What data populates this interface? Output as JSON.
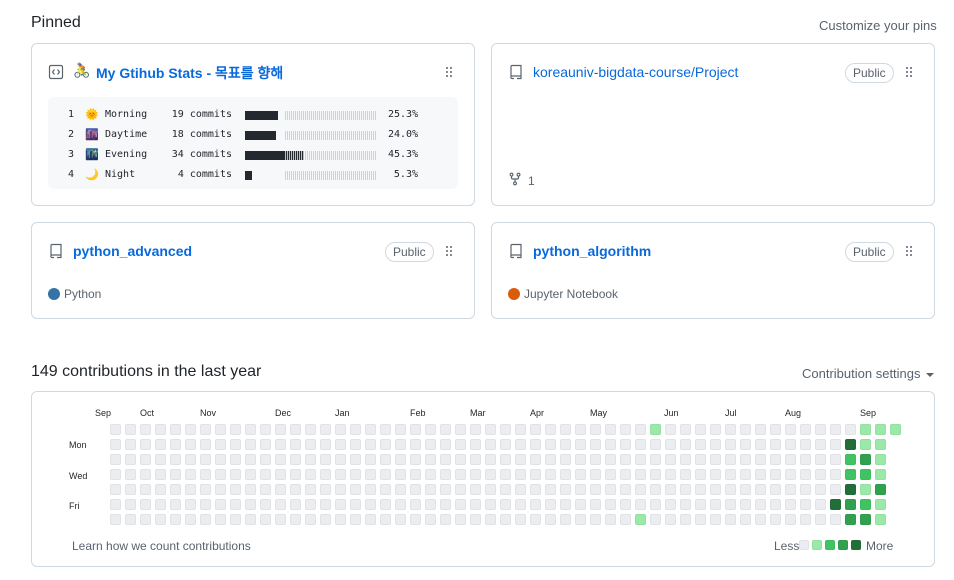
{
  "pinned": {
    "title": "Pinned",
    "customize_label": "Customize your pins",
    "cards": [
      {
        "name": "My Gtihub Stats - 목표를 향해",
        "emoji": "🚴",
        "type": "gist",
        "stats": [
          {
            "num": "1",
            "emoji": "🌞",
            "label": "Morning",
            "commits": "19 commits",
            "percent": "25.3%",
            "fraction": 0.253
          },
          {
            "num": "2",
            "emoji": "🌆",
            "label": "Daytime",
            "commits": "18 commits",
            "percent": "24.0%",
            "fraction": 0.24
          },
          {
            "num": "3",
            "emoji": "🌃",
            "label": "Evening",
            "commits": "34 commits",
            "percent": "45.3%",
            "fraction": 0.453
          },
          {
            "num": "4",
            "emoji": "🌙",
            "label": "Night",
            "commits": "4 commits",
            "percent": "5.3%",
            "fraction": 0.053
          }
        ]
      },
      {
        "name": "koreauniv-bigdata-course/Project",
        "badge": "Public",
        "forks": "1"
      },
      {
        "name": "python_advanced",
        "badge": "Public",
        "language": "Python",
        "language_color": "#3572A5"
      },
      {
        "name": "python_algorithm",
        "badge": "Public",
        "language": "Jupyter Notebook",
        "language_color": "#DA5B0B"
      }
    ]
  },
  "contributions": {
    "title": "149 contributions in the last year",
    "settings_label": "Contribution settings",
    "months": [
      "Sep",
      "Oct",
      "Nov",
      "Dec",
      "Jan",
      "Feb",
      "Mar",
      "Apr",
      "May",
      "Jun",
      "Jul",
      "Aug",
      "Sep"
    ],
    "days": [
      "Mon",
      "Wed",
      "Fri"
    ],
    "learn_label": "Learn how we count contributions",
    "less_label": "Less",
    "more_label": "More",
    "colors": [
      "#ebedf0",
      "#9be9a8",
      "#40c463",
      "#30a14e",
      "#216e39"
    ],
    "active_cells": [
      {
        "week": 38,
        "day": 0,
        "level": 1
      },
      {
        "week": 37,
        "day": 6,
        "level": 1
      },
      {
        "week": 50,
        "day": 5,
        "level": 4
      },
      {
        "week": 51,
        "day": 1,
        "level": 4
      },
      {
        "week": 51,
        "day": 2,
        "level": 2
      },
      {
        "week": 51,
        "day": 3,
        "level": 2
      },
      {
        "week": 51,
        "day": 4,
        "level": 4
      },
      {
        "week": 51,
        "day": 5,
        "level": 3
      },
      {
        "week": 51,
        "day": 6,
        "level": 3
      },
      {
        "week": 52,
        "day": 0,
        "level": 1
      },
      {
        "week": 52,
        "day": 1,
        "level": 1
      },
      {
        "week": 52,
        "day": 2,
        "level": 3
      },
      {
        "week": 52,
        "day": 3,
        "level": 2
      },
      {
        "week": 52,
        "day": 4,
        "level": 1
      },
      {
        "week": 52,
        "day": 5,
        "level": 2
      },
      {
        "week": 52,
        "day": 6,
        "level": 3
      },
      {
        "week": 53,
        "day": 0,
        "level": 1
      },
      {
        "week": 53,
        "day": 1,
        "level": 1
      },
      {
        "week": 53,
        "day": 2,
        "level": 1
      },
      {
        "week": 53,
        "day": 3,
        "level": 1
      },
      {
        "week": 53,
        "day": 4,
        "level": 3
      },
      {
        "week": 53,
        "day": 5,
        "level": 1
      },
      {
        "week": 53,
        "day": 6,
        "level": 1
      },
      {
        "week": 54,
        "day": 0,
        "level": 1
      },
      {
        "week": 54,
        "day": 1,
        "level": 1
      },
      {
        "week": 54,
        "day": 2,
        "level": 4
      },
      {
        "week": 54,
        "day": 3,
        "level": 1
      },
      {
        "week": 54,
        "day": 4,
        "level": 1
      },
      {
        "week": 54,
        "day": 5,
        "level": 1
      },
      {
        "week": 54,
        "day": 6,
        "level": 1
      }
    ]
  }
}
